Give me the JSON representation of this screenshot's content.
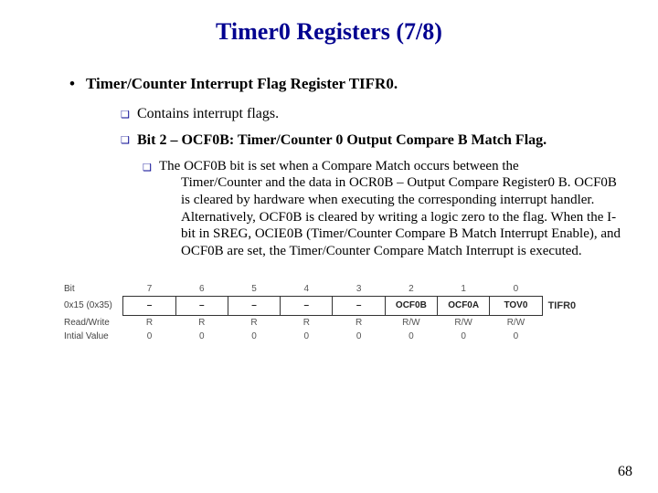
{
  "title": "Timer0 Registers (7/8)",
  "bullet1": "Timer/Counter Interrupt Flag Register TIFR0.",
  "bullet2a": "Contains interrupt flags.",
  "bullet2b": "Bit 2 – OCF0B: Timer/Counter 0 Output Compare B Match Flag.",
  "bullet3lead": "The OCF0B bit is set when a Compare Match occurs between the",
  "bullet3rest": "Timer/Counter and the data in OCR0B – Output Compare Register0 B. OCF0B is cleared by hardware when executing the corresponding interrupt handler. Alternatively, OCF0B is cleared by writing a logic zero to the flag. When the I-bit in SREG, OCIE0B (Timer/Counter Compare B Match Interrupt Enable), and OCF0B are set, the Timer/Counter Compare Match Interrupt is executed.",
  "reg": {
    "row_labels": {
      "bit": "Bit",
      "addr": "0x15 (0x35)",
      "rw": "Read/Write",
      "init": "Intial Value"
    },
    "bits": [
      "7",
      "6",
      "5",
      "4",
      "3",
      "2",
      "1",
      "0"
    ],
    "names": [
      "–",
      "–",
      "–",
      "–",
      "–",
      "OCF0B",
      "OCF0A",
      "TOV0"
    ],
    "rw": [
      "R",
      "R",
      "R",
      "R",
      "R",
      "R/W",
      "R/W",
      "R/W"
    ],
    "init": [
      "0",
      "0",
      "0",
      "0",
      "0",
      "0",
      "0",
      "0"
    ],
    "regname": "TIFR0"
  },
  "page": "68"
}
